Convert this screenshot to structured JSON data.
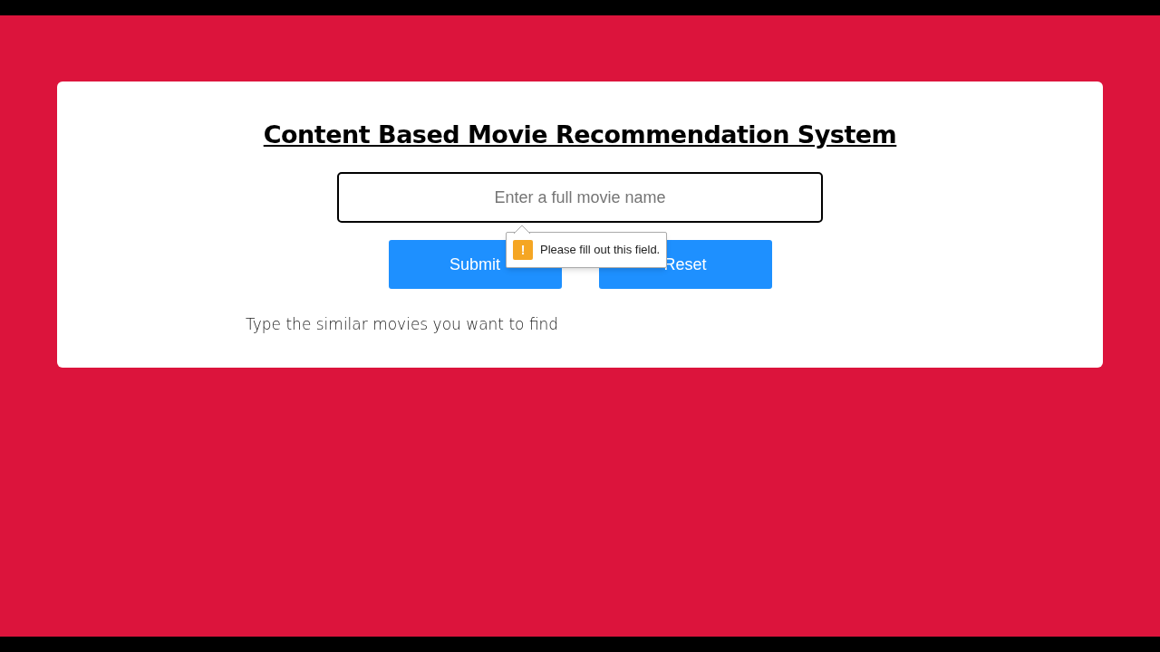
{
  "title": "Content Based Movie Recommendation System",
  "search": {
    "placeholder": "Enter a full movie name"
  },
  "buttons": [
    {
      "label": "Submit"
    },
    {
      "label": "Reset"
    }
  ],
  "tooltip": {
    "icon": "!",
    "text": "Please fill out this field."
  },
  "hint": "Type the similar movies you want to find"
}
